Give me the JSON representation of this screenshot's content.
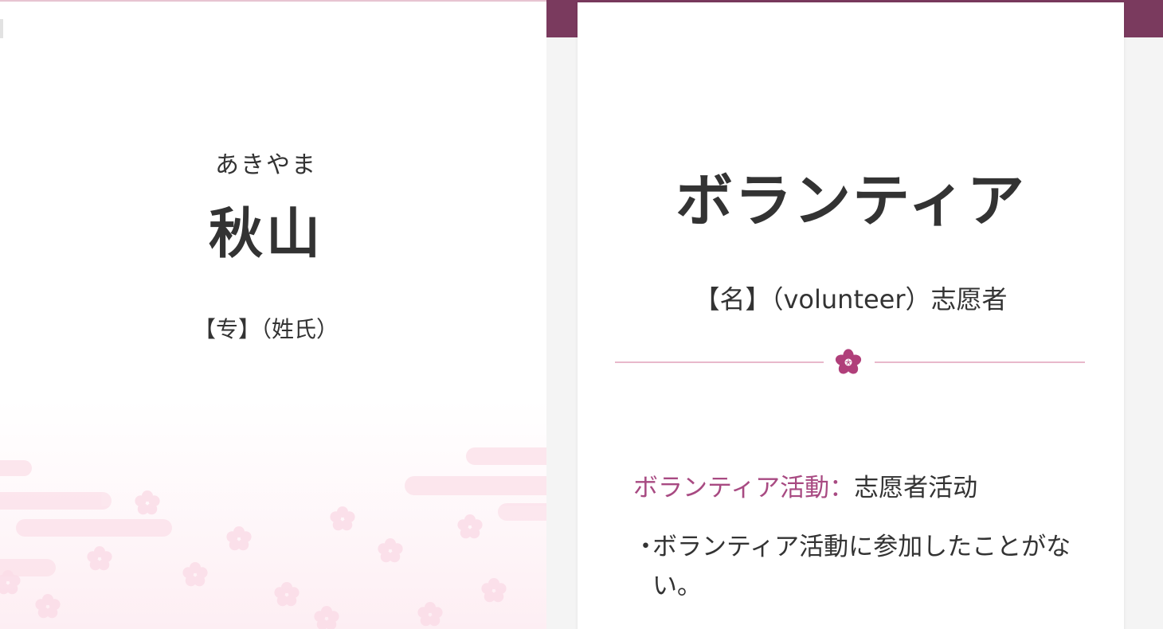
{
  "left_card": {
    "reading": "あきやま",
    "kanji": "秋山",
    "meaning": "【专】（姓氏）"
  },
  "right_card": {
    "word": "ボランティア",
    "meaning": "【名】（volunteer）志愿者",
    "divider_icon": "sakura-flower-icon",
    "phrase_key": "ボランティア活動",
    "phrase_sep": "：",
    "phrase_value": "志愿者活动",
    "example_bullet": "・",
    "example_text": "ボランティア活動に参加したことがない。"
  },
  "colors": {
    "accent_band": "#7a3a5e",
    "phrase_key": "#a84a82",
    "divider_line": "#e8b8cb",
    "text": "#333333"
  }
}
